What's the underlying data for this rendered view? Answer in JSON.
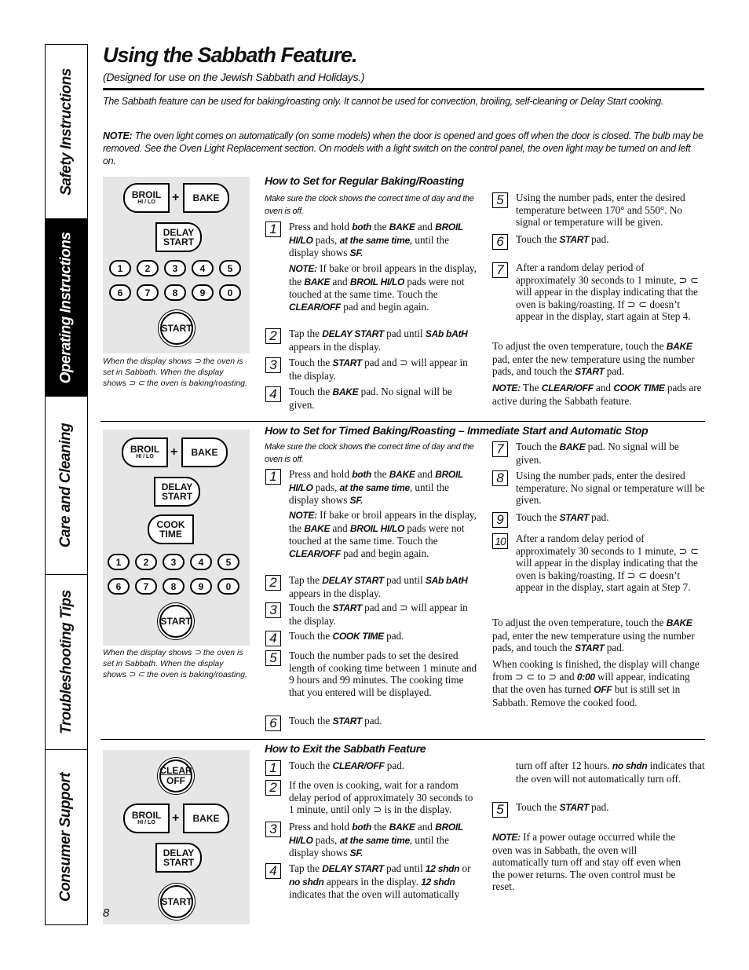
{
  "sidebar": {
    "tabs": [
      {
        "label": "Safety Instructions",
        "active": false
      },
      {
        "label": "Operating Instructions",
        "active": true
      },
      {
        "label": "Care and Cleaning",
        "active": false
      },
      {
        "label": "Troubleshooting Tips",
        "active": false
      },
      {
        "label": "Consumer Support",
        "active": false
      }
    ]
  },
  "header": {
    "title": "Using the Sabbath Feature.",
    "subtitle": "(Designed for use on the Jewish Sabbath and Holidays.)"
  },
  "intro": {
    "text": "The Sabbath feature can be used for baking/roasting only. It cannot be used for convection, broiling, self-cleaning or Delay Start cooking.",
    "note_label": "NOTE:",
    "note_text": " The oven light comes on automatically (on some models) when the door is opened and goes off when the door is closed. The bulb may be removed. See the Oven Light Replacement section. On models with a light switch on the control panel, the oven light may be turned on and left on."
  },
  "pads": {
    "broil": "BROIL",
    "broil_sub": "HI / LO",
    "plus": "+",
    "bake": "BAKE",
    "delay_1": "DELAY",
    "delay_2": "START",
    "cook_1": "COOK",
    "cook_2": "TIME",
    "start": "START",
    "clear_1": "CLEAR",
    "clear_2": "OFF",
    "numbers": [
      "1",
      "2",
      "3",
      "4",
      "5",
      "6",
      "7",
      "8",
      "9",
      "0"
    ]
  },
  "caption": "When the display shows ⊃ the oven is set in Sabbath. When the display shows ⊃ ⊂ the oven is baking/roasting.",
  "section1": {
    "heading": "How to Set for Regular Baking/Roasting",
    "prereq": "Make sure the clock shows the correct time of day and the oven is off.",
    "steps": [
      {
        "num": "1",
        "html": "Press and hold <b class='k'>both</b> the <b class='k'>BAKE</b> and <b class='k'>BROIL HI/LO</b> pads, <b class='k'>at the same time</b>, until the display shows <b class='k'>SF.</b>"
      },
      {
        "num": "",
        "html": "<b class='k'>NOTE:</b> If bake or broil appears in the display, the <b class='k'>BAKE</b> and <b class='k'>BROIL HI/LO</b> pads were not touched at the same time. Touch the <b class='k'>CLEAR/OFF</b> pad and begin again."
      },
      {
        "num": "2",
        "html": "Tap the <b class='k'>DELAY START</b> pad until <b class='k'>SAb bAtH</b> appears in the display."
      },
      {
        "num": "3",
        "html": "Touch the <b class='k'>START</b> pad and ⊃ will appear in the display."
      },
      {
        "num": "4",
        "html": "Touch the <b class='k'>BAKE</b> pad. No signal will be given."
      },
      {
        "num": "5",
        "html": "Using the number pads, enter the desired temperature between 170° and 550°. No signal or temperature will be given."
      },
      {
        "num": "6",
        "html": "Touch the <b class='k'>START</b> pad."
      },
      {
        "num": "7",
        "html": "After a random delay period of approximately 30 seconds to 1 minute, ⊃ ⊂ will appear in the display indicating that the oven is baking/roasting. If ⊃ ⊂ doesn’t appear in the display, start again at Step 4."
      }
    ],
    "adjust": "To adjust the oven temperature, touch the <b class='k'>BAKE</b> pad, enter the new temperature using the number pads, and touch the <b class='k'>START</b> pad.",
    "note": "<b class='k'>NOTE:</b> The <b class='k'>CLEAR/OFF</b> and <b class='k'>COOK TIME</b> pads are active during the Sabbath feature."
  },
  "section2": {
    "heading": "How to Set for Timed Baking/Roasting – Immediate Start and Automatic Stop",
    "prereq": "Make sure the clock shows the correct time of day and the oven is off.",
    "steps": [
      {
        "num": "1",
        "html": "Press and hold <b class='k'>both</b> the <b class='k'>BAKE</b> and <b class='k'>BROIL HI/LO</b> pads, <b class='k'>at the same time</b>, until the display shows <b class='k'>SF.</b>"
      },
      {
        "num": "",
        "html": "<b class='k'>NOTE:</b> If bake or broil appears in the display, the <b class='k'>BAKE</b> and <b class='k'>BROIL HI/LO</b> pads were not touched at the same time. Touch the <b class='k'>CLEAR/OFF</b> pad and begin again."
      },
      {
        "num": "2",
        "html": "Tap the <b class='k'>DELAY START</b> pad until <b class='k'>SAb bAtH</b> appears in the display."
      },
      {
        "num": "3",
        "html": "Touch the <b class='k'>START</b> pad and ⊃ will appear in the display."
      },
      {
        "num": "4",
        "html": "Touch the <b class='k'>COOK TIME</b> pad."
      },
      {
        "num": "5",
        "html": "Touch the number pads to set the desired length of cooking time between 1 minute and 9 hours and 99 minutes. The cooking time that you entered will be displayed."
      },
      {
        "num": "6",
        "html": "Touch the <b class='k'>START</b> pad."
      },
      {
        "num": "7",
        "html": "Touch the <b class='k'>BAKE</b> pad. No signal will be given."
      },
      {
        "num": "8",
        "html": "Using the number pads, enter the desired temperature. No signal or temperature will be given."
      },
      {
        "num": "9",
        "html": "Touch the <b class='k'>START</b> pad."
      },
      {
        "num": "10",
        "html": "After a random delay period of approximately 30 seconds to 1 minute, ⊃ ⊂ will appear in the display indicating that the oven is baking/roasting. If ⊃ ⊂ doesn’t appear in the display, start again at Step 7."
      }
    ],
    "adjust": "To adjust the oven temperature, touch the <b class='k'>BAKE</b> pad, enter the new temperature using the number pads, and touch the <b class='k'>START</b> pad.",
    "finish": "When cooking is finished, the display will change from ⊃ ⊂ to ⊃ and <b class='k'>0:00</b> will appear, indicating that the oven has turned <b class='k'>OFF</b> but is still set in Sabbath. Remove the cooked food."
  },
  "section3": {
    "heading": "How to Exit the Sabbath Feature",
    "steps": [
      {
        "num": "1",
        "html": "Touch the <b class='k'>CLEAR/OFF</b> pad."
      },
      {
        "num": "2",
        "html": "If the oven is cooking, wait for a random delay period of approximately 30 seconds to 1 minute, until only ⊃ is in the display."
      },
      {
        "num": "3",
        "html": "Press and hold <b class='k'>both</b> the <b class='k'>BAKE</b> and <b class='k'>BROIL HI/LO</b> pads, <b class='k'>at the same time</b>, until the display shows <b class='k'>SF.</b>"
      },
      {
        "num": "4",
        "html": "Tap the <b class='k'>DELAY START</b> pad until <b class='k'>12 shdn</b> or <b class='k'>no shdn</b> appears in the display. <b class='k'>12 shdn</b> indicates that the oven will automatically"
      },
      {
        "num": "",
        "html": "turn off after 12 hours. <b class='k'>no shdn</b> indicates that the oven will not automatically turn off."
      },
      {
        "num": "5",
        "html": "Touch the <b class='k'>START</b> pad."
      }
    ],
    "note": "<b class='k'>NOTE:</b> If a power outage occurred while the oven was in Sabbath, the oven will automatically turn off and stay off even when the power returns. The oven control must be reset."
  },
  "page_number": "8"
}
